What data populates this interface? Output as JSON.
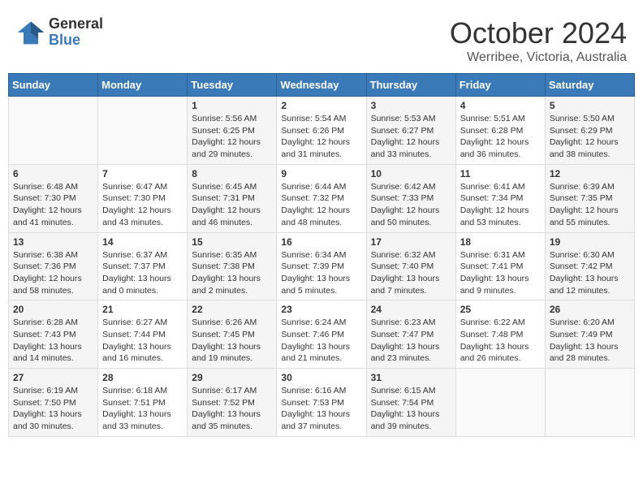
{
  "logo": {
    "general": "General",
    "blue": "Blue"
  },
  "title": "October 2024",
  "location": "Werribee, Victoria, Australia",
  "days_of_week": [
    "Sunday",
    "Monday",
    "Tuesday",
    "Wednesday",
    "Thursday",
    "Friday",
    "Saturday"
  ],
  "weeks": [
    [
      {
        "day": "",
        "sunrise": "",
        "sunset": "",
        "daylight": ""
      },
      {
        "day": "",
        "sunrise": "",
        "sunset": "",
        "daylight": ""
      },
      {
        "day": "1",
        "sunrise": "Sunrise: 5:56 AM",
        "sunset": "Sunset: 6:25 PM",
        "daylight": "Daylight: 12 hours and 29 minutes."
      },
      {
        "day": "2",
        "sunrise": "Sunrise: 5:54 AM",
        "sunset": "Sunset: 6:26 PM",
        "daylight": "Daylight: 12 hours and 31 minutes."
      },
      {
        "day": "3",
        "sunrise": "Sunrise: 5:53 AM",
        "sunset": "Sunset: 6:27 PM",
        "daylight": "Daylight: 12 hours and 33 minutes."
      },
      {
        "day": "4",
        "sunrise": "Sunrise: 5:51 AM",
        "sunset": "Sunset: 6:28 PM",
        "daylight": "Daylight: 12 hours and 36 minutes."
      },
      {
        "day": "5",
        "sunrise": "Sunrise: 5:50 AM",
        "sunset": "Sunset: 6:29 PM",
        "daylight": "Daylight: 12 hours and 38 minutes."
      }
    ],
    [
      {
        "day": "6",
        "sunrise": "Sunrise: 6:48 AM",
        "sunset": "Sunset: 7:30 PM",
        "daylight": "Daylight: 12 hours and 41 minutes."
      },
      {
        "day": "7",
        "sunrise": "Sunrise: 6:47 AM",
        "sunset": "Sunset: 7:30 PM",
        "daylight": "Daylight: 12 hours and 43 minutes."
      },
      {
        "day": "8",
        "sunrise": "Sunrise: 6:45 AM",
        "sunset": "Sunset: 7:31 PM",
        "daylight": "Daylight: 12 hours and 46 minutes."
      },
      {
        "day": "9",
        "sunrise": "Sunrise: 6:44 AM",
        "sunset": "Sunset: 7:32 PM",
        "daylight": "Daylight: 12 hours and 48 minutes."
      },
      {
        "day": "10",
        "sunrise": "Sunrise: 6:42 AM",
        "sunset": "Sunset: 7:33 PM",
        "daylight": "Daylight: 12 hours and 50 minutes."
      },
      {
        "day": "11",
        "sunrise": "Sunrise: 6:41 AM",
        "sunset": "Sunset: 7:34 PM",
        "daylight": "Daylight: 12 hours and 53 minutes."
      },
      {
        "day": "12",
        "sunrise": "Sunrise: 6:39 AM",
        "sunset": "Sunset: 7:35 PM",
        "daylight": "Daylight: 12 hours and 55 minutes."
      }
    ],
    [
      {
        "day": "13",
        "sunrise": "Sunrise: 6:38 AM",
        "sunset": "Sunset: 7:36 PM",
        "daylight": "Daylight: 12 hours and 58 minutes."
      },
      {
        "day": "14",
        "sunrise": "Sunrise: 6:37 AM",
        "sunset": "Sunset: 7:37 PM",
        "daylight": "Daylight: 13 hours and 0 minutes."
      },
      {
        "day": "15",
        "sunrise": "Sunrise: 6:35 AM",
        "sunset": "Sunset: 7:38 PM",
        "daylight": "Daylight: 13 hours and 2 minutes."
      },
      {
        "day": "16",
        "sunrise": "Sunrise: 6:34 AM",
        "sunset": "Sunset: 7:39 PM",
        "daylight": "Daylight: 13 hours and 5 minutes."
      },
      {
        "day": "17",
        "sunrise": "Sunrise: 6:32 AM",
        "sunset": "Sunset: 7:40 PM",
        "daylight": "Daylight: 13 hours and 7 minutes."
      },
      {
        "day": "18",
        "sunrise": "Sunrise: 6:31 AM",
        "sunset": "Sunset: 7:41 PM",
        "daylight": "Daylight: 13 hours and 9 minutes."
      },
      {
        "day": "19",
        "sunrise": "Sunrise: 6:30 AM",
        "sunset": "Sunset: 7:42 PM",
        "daylight": "Daylight: 13 hours and 12 minutes."
      }
    ],
    [
      {
        "day": "20",
        "sunrise": "Sunrise: 6:28 AM",
        "sunset": "Sunset: 7:43 PM",
        "daylight": "Daylight: 13 hours and 14 minutes."
      },
      {
        "day": "21",
        "sunrise": "Sunrise: 6:27 AM",
        "sunset": "Sunset: 7:44 PM",
        "daylight": "Daylight: 13 hours and 16 minutes."
      },
      {
        "day": "22",
        "sunrise": "Sunrise: 6:26 AM",
        "sunset": "Sunset: 7:45 PM",
        "daylight": "Daylight: 13 hours and 19 minutes."
      },
      {
        "day": "23",
        "sunrise": "Sunrise: 6:24 AM",
        "sunset": "Sunset: 7:46 PM",
        "daylight": "Daylight: 13 hours and 21 minutes."
      },
      {
        "day": "24",
        "sunrise": "Sunrise: 6:23 AM",
        "sunset": "Sunset: 7:47 PM",
        "daylight": "Daylight: 13 hours and 23 minutes."
      },
      {
        "day": "25",
        "sunrise": "Sunrise: 6:22 AM",
        "sunset": "Sunset: 7:48 PM",
        "daylight": "Daylight: 13 hours and 26 minutes."
      },
      {
        "day": "26",
        "sunrise": "Sunrise: 6:20 AM",
        "sunset": "Sunset: 7:49 PM",
        "daylight": "Daylight: 13 hours and 28 minutes."
      }
    ],
    [
      {
        "day": "27",
        "sunrise": "Sunrise: 6:19 AM",
        "sunset": "Sunset: 7:50 PM",
        "daylight": "Daylight: 13 hours and 30 minutes."
      },
      {
        "day": "28",
        "sunrise": "Sunrise: 6:18 AM",
        "sunset": "Sunset: 7:51 PM",
        "daylight": "Daylight: 13 hours and 33 minutes."
      },
      {
        "day": "29",
        "sunrise": "Sunrise: 6:17 AM",
        "sunset": "Sunset: 7:52 PM",
        "daylight": "Daylight: 13 hours and 35 minutes."
      },
      {
        "day": "30",
        "sunrise": "Sunrise: 6:16 AM",
        "sunset": "Sunset: 7:53 PM",
        "daylight": "Daylight: 13 hours and 37 minutes."
      },
      {
        "day": "31",
        "sunrise": "Sunrise: 6:15 AM",
        "sunset": "Sunset: 7:54 PM",
        "daylight": "Daylight: 13 hours and 39 minutes."
      },
      {
        "day": "",
        "sunrise": "",
        "sunset": "",
        "daylight": ""
      },
      {
        "day": "",
        "sunrise": "",
        "sunset": "",
        "daylight": ""
      }
    ]
  ]
}
